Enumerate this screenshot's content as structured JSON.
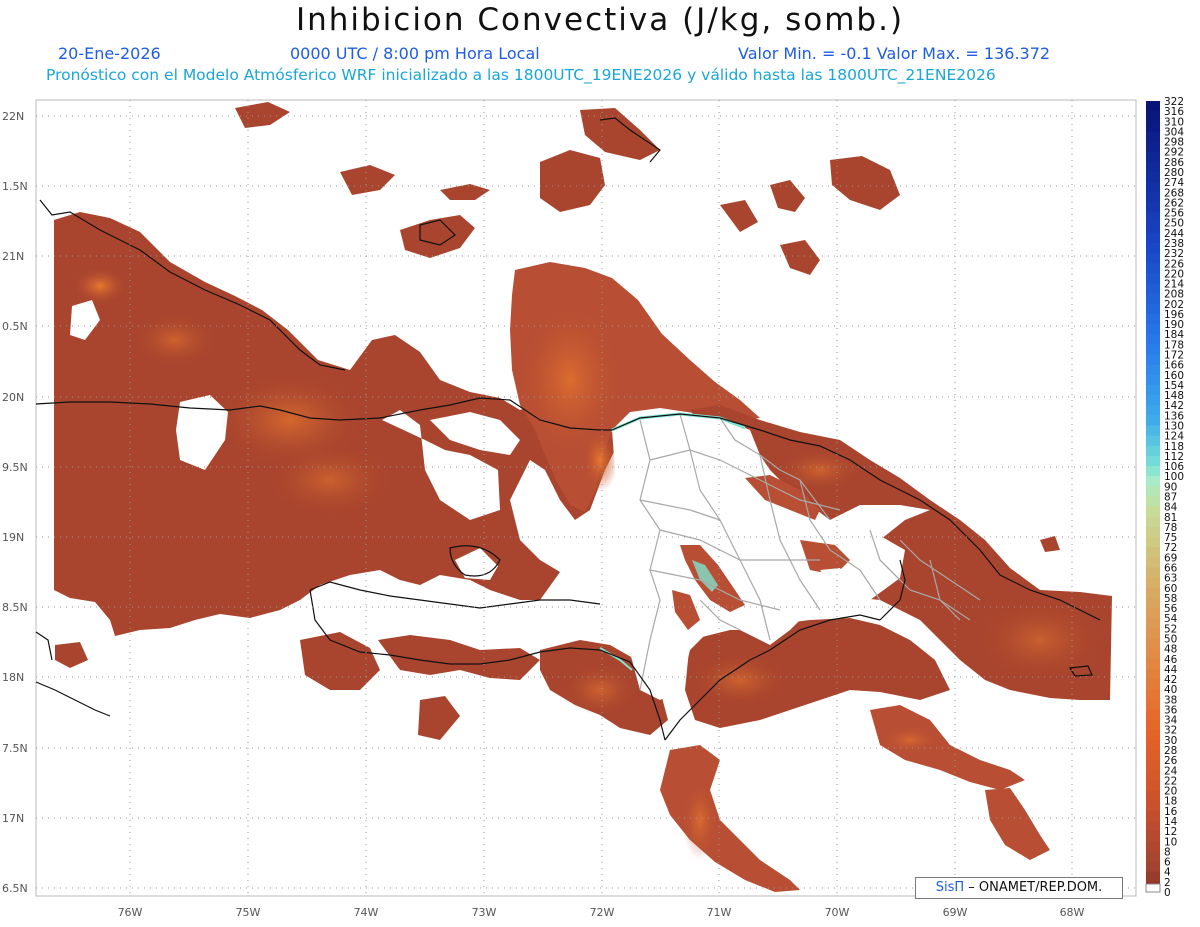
{
  "title": "Inhibicion Convectiva (J/kg, somb.)",
  "date": "20-Ene-2026",
  "time": "0000 UTC / 8:00 pm Hora Local",
  "minmax": "Valor Min. = -0.1  Valor Max. = 136.372",
  "forecast": "Pronóstico con el Modelo Atmósferico WRF inicializado a las 1800UTC_19ENE2026 y válido hasta las  1800UTC_21ENE2026",
  "credit_logo": "SisΠ",
  "credit_text": "– ONAMET/REP.DOM.",
  "lon_labels": [
    "76W",
    "75W",
    "74W",
    "73W",
    "72W",
    "71W",
    "70W",
    "69W",
    "68W"
  ],
  "lat_labels": [
    "22N",
    "1.5N",
    "21N",
    "0.5N",
    "20N",
    "9.5N",
    "19N",
    "8.5N",
    "18N",
    "7.5N",
    "17N",
    "6.5N"
  ],
  "colorbar": {
    "labels": [
      "322",
      "316",
      "310",
      "304",
      "298",
      "292",
      "286",
      "280",
      "274",
      "268",
      "262",
      "256",
      "250",
      "244",
      "238",
      "232",
      "226",
      "220",
      "214",
      "208",
      "202",
      "196",
      "190",
      "184",
      "178",
      "172",
      "166",
      "160",
      "154",
      "148",
      "142",
      "136",
      "130",
      "124",
      "118",
      "112",
      "106",
      "100",
      "90",
      "87",
      "84",
      "81",
      "78",
      "75",
      "72",
      "69",
      "66",
      "63",
      "60",
      "58",
      "56",
      "54",
      "52",
      "50",
      "48",
      "46",
      "44",
      "42",
      "40",
      "38",
      "36",
      "34",
      "32",
      "30",
      "28",
      "26",
      "24",
      "22",
      "20",
      "18",
      "16",
      "14",
      "12",
      "10",
      "8",
      "6",
      "4",
      "2",
      "0"
    ]
  },
  "colors": {
    "field_dark": "#a9452e",
    "field_mid": "#b84e33",
    "field_orange": "#e2642a",
    "field_cyan": "#7fe3d0",
    "subtitle_blue": "#1e5ce6",
    "subtitle_cyan": "#1aa6d8"
  }
}
